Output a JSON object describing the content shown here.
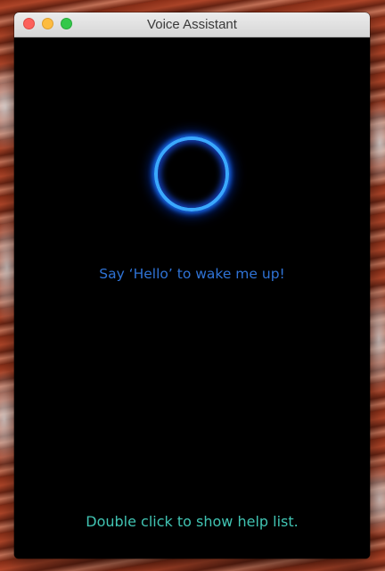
{
  "window": {
    "title": "Voice Assistant"
  },
  "main": {
    "prompt_text": "Say ‘Hello’ to wake me up!",
    "help_text": "Double click to show help list."
  },
  "colors": {
    "orb_ring": "#3aa8ff",
    "prompt_text": "#2f73d6",
    "help_text": "#41c4b3",
    "background": "#000000"
  },
  "icons": {
    "close": "close-icon",
    "minimize": "minimize-icon",
    "maximize": "maximize-icon",
    "orb": "listening-orb-icon"
  }
}
